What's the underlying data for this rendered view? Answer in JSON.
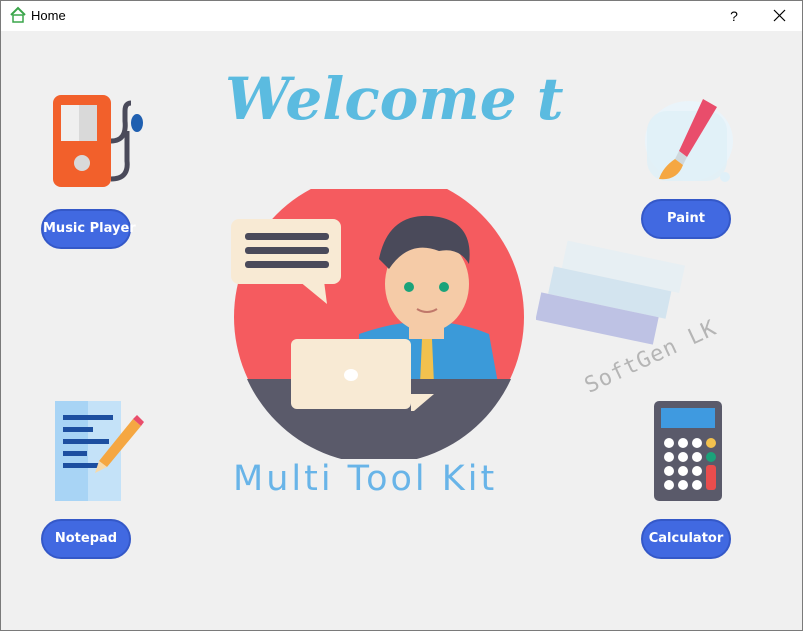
{
  "window": {
    "title": "Home",
    "help_label": "?",
    "icons": {
      "app": "home-icon",
      "close": "close-icon"
    }
  },
  "header": {
    "welcome_text": "Welcome to",
    "welcome_color": "#5bbbe0"
  },
  "main": {
    "app_title": "Multi Tool Kit",
    "app_title_color": "#68b4e8",
    "watermark": "SoftGen LK"
  },
  "apps": [
    {
      "label": "Music Player",
      "icon": "music-player-icon"
    },
    {
      "label": "Paint",
      "icon": "paint-brush-icon"
    },
    {
      "label": "Notepad",
      "icon": "notepad-icon"
    },
    {
      "label": "Calculator",
      "icon": "calculator-icon"
    }
  ],
  "colors": {
    "button": "#4169e1",
    "hero_circle": "#f55b5f",
    "desk": "#5a5a6a"
  }
}
